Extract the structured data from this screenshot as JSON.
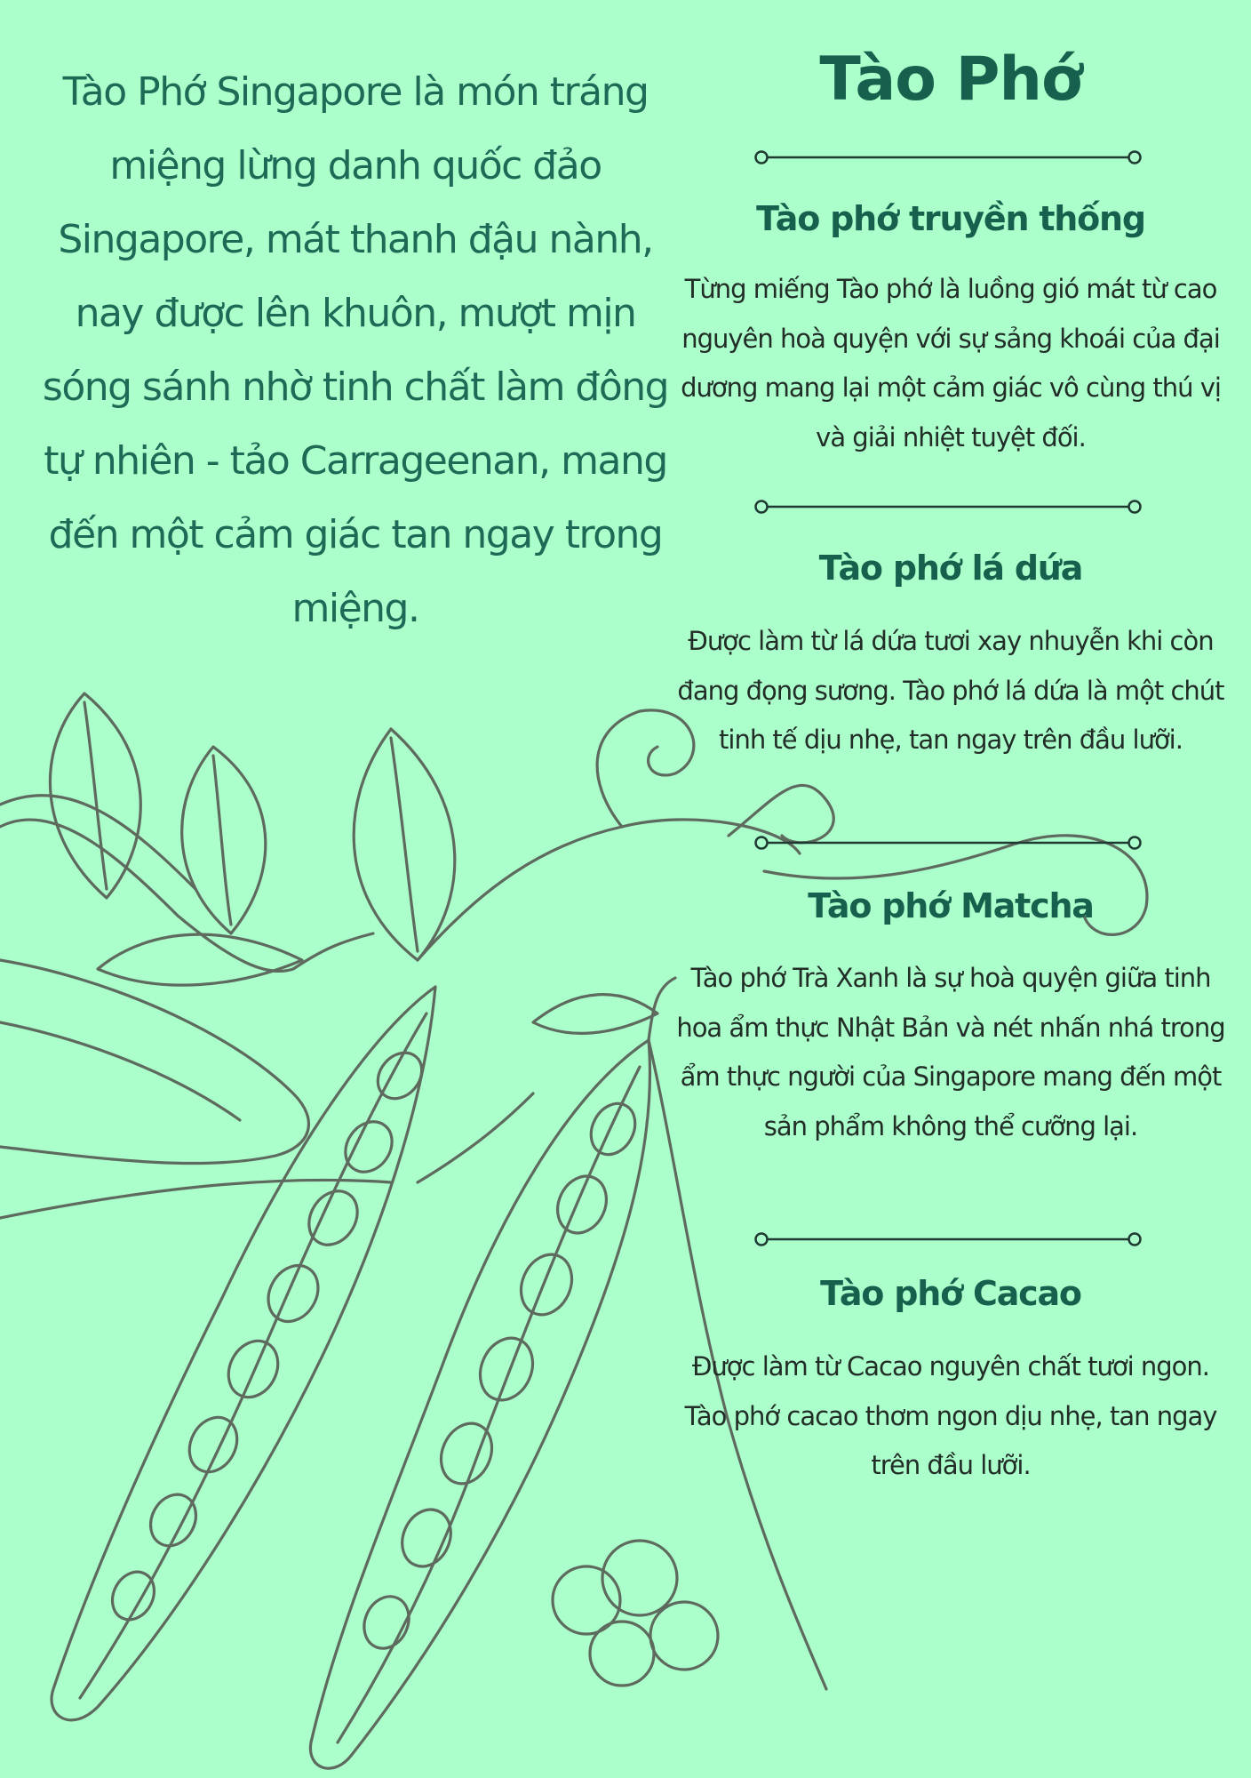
{
  "intro": {
    "text": "Tào Phớ Singapore là món tráng miệng lừng danh quốc đảo Singapore, mát thanh đậu nành, nay được lên khuôn, mượt mịn sóng sánh nhờ tinh chất làm đông tự nhiên - tảo Carrageenan, mang đến một cảm giác tan ngay trong miệng."
  },
  "menu": {
    "title": "Tào Phớ",
    "sections": [
      {
        "title": "Tào phớ truyền thống",
        "description": "Từng miếng Tào phớ là luồng gió mát từ cao nguyên hoà quyện với sự sảng khoái của đại dương mang lại một cảm giác vô cùng thú vị và giải nhiệt tuyệt đối."
      },
      {
        "title": "Tào phớ lá dứa",
        "description": "Được làm từ lá dứa tươi xay nhuyễn khi còn đang đọng sương. Tào phớ lá dứa là một chút tinh tế dịu nhẹ, tan ngay trên đầu lưỡi."
      },
      {
        "title": "Tào phớ Matcha",
        "description": "Tào phớ Trà Xanh là sự hoà quyện giữa tinh hoa ẩm thực Nhật Bản và nét nhấn nhá trong ẩm thực người của Singapore mang đến một sản phẩm không thể cưỡng lại."
      },
      {
        "title": "Tào phớ Cacao",
        "description": "Được làm từ Cacao nguyên chất tươi ngon. Tào phớ cacao thơm ngon dịu nhẹ, tan ngay trên đầu lưỡi."
      }
    ]
  },
  "colors": {
    "background": "#aaffca",
    "heading": "#17604e",
    "intro_text": "#1f6a57",
    "body_text": "#222d28",
    "sketch": "#5e6a5e"
  },
  "icons": {
    "illustration": "pea-pod-sketch-icon",
    "divider": "line-divider-icon"
  }
}
